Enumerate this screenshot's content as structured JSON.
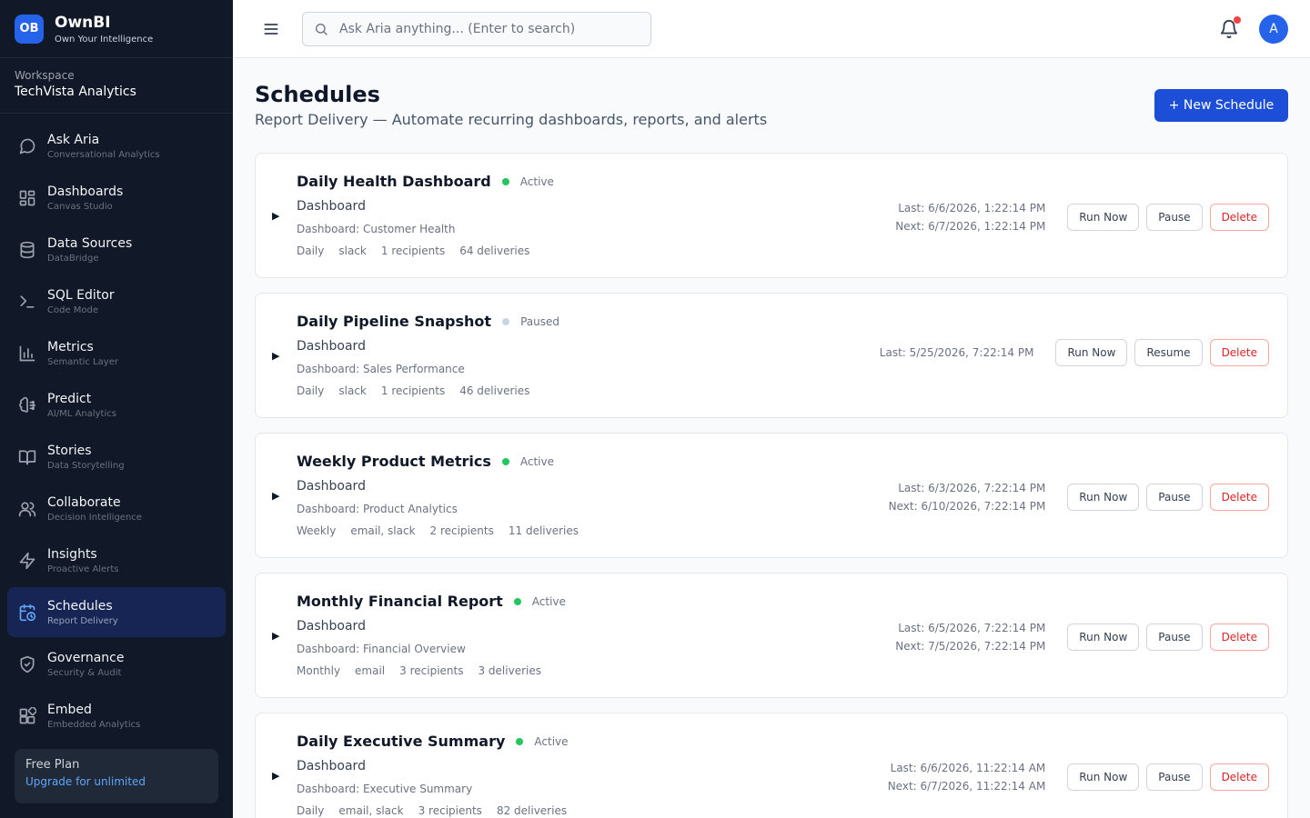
{
  "brand": {
    "logo": "OB",
    "name": "OwnBI",
    "tagline": "Own Your Intelligence"
  },
  "workspace": {
    "label": "Workspace",
    "name": "TechVista Analytics"
  },
  "nav": [
    {
      "label": "Ask Aria",
      "sub": "Conversational Analytics",
      "icon": "chat-bubble-icon"
    },
    {
      "label": "Dashboards",
      "sub": "Canvas Studio",
      "icon": "grid-icon"
    },
    {
      "label": "Data Sources",
      "sub": "DataBridge",
      "icon": "database-icon"
    },
    {
      "label": "SQL Editor",
      "sub": "Code Mode",
      "icon": "terminal-icon"
    },
    {
      "label": "Metrics",
      "sub": "Semantic Layer",
      "icon": "bar-chart-icon"
    },
    {
      "label": "Predict",
      "sub": "AI/ML Analytics",
      "icon": "brain-icon"
    },
    {
      "label": "Stories",
      "sub": "Data Storytelling",
      "icon": "book-icon"
    },
    {
      "label": "Collaborate",
      "sub": "Decision Intelligence",
      "icon": "users-icon"
    },
    {
      "label": "Insights",
      "sub": "Proactive Alerts",
      "icon": "lightning-icon"
    },
    {
      "label": "Schedules",
      "sub": "Report Delivery",
      "icon": "calendar-clock-icon",
      "active": true
    },
    {
      "label": "Governance",
      "sub": "Security & Audit",
      "icon": "shield-icon"
    },
    {
      "label": "Embed",
      "sub": "Embedded Analytics",
      "icon": "blocks-icon"
    }
  ],
  "plan": {
    "name": "Free Plan",
    "link": "Upgrade for unlimited"
  },
  "topbar": {
    "search_placeholder": "Ask Aria anything... (Enter to search)",
    "avatar": "A"
  },
  "page": {
    "title": "Schedules",
    "subtitle": "Report Delivery — Automate recurring dashboards, reports, and alerts",
    "new_button": "+ New Schedule"
  },
  "colors": {
    "active": "#22c55e",
    "paused": "#cbd5e1",
    "primary": "#1d4ed8",
    "sidebar": "#111827"
  },
  "schedules": [
    {
      "name": "Daily Health Dashboard",
      "status": "Active",
      "type": "Dashboard",
      "target": "Dashboard: Customer Health",
      "frequency": "Daily",
      "channels": "slack",
      "recipients": "1 recipients",
      "deliveries": "64 deliveries",
      "last": "Last: 6/6/2026, 1:22:14 PM",
      "next": "Next: 6/7/2026, 1:22:14 PM",
      "run": "Run Now",
      "toggle": "Pause",
      "delete": "Delete"
    },
    {
      "name": "Daily Pipeline Snapshot",
      "status": "Paused",
      "type": "Dashboard",
      "target": "Dashboard: Sales Performance",
      "frequency": "Daily",
      "channels": "slack",
      "recipients": "1 recipients",
      "deliveries": "46 deliveries",
      "last": "Last: 5/25/2026, 7:22:14 PM",
      "next": "",
      "run": "Run Now",
      "toggle": "Resume",
      "delete": "Delete"
    },
    {
      "name": "Weekly Product Metrics",
      "status": "Active",
      "type": "Dashboard",
      "target": "Dashboard: Product Analytics",
      "frequency": "Weekly",
      "channels": "email, slack",
      "recipients": "2 recipients",
      "deliveries": "11 deliveries",
      "last": "Last: 6/3/2026, 7:22:14 PM",
      "next": "Next: 6/10/2026, 7:22:14 PM",
      "run": "Run Now",
      "toggle": "Pause",
      "delete": "Delete"
    },
    {
      "name": "Monthly Financial Report",
      "status": "Active",
      "type": "Dashboard",
      "target": "Dashboard: Financial Overview",
      "frequency": "Monthly",
      "channels": "email",
      "recipients": "3 recipients",
      "deliveries": "3 deliveries",
      "last": "Last: 6/5/2026, 7:22:14 PM",
      "next": "Next: 7/5/2026, 7:22:14 PM",
      "run": "Run Now",
      "toggle": "Pause",
      "delete": "Delete"
    },
    {
      "name": "Daily Executive Summary",
      "status": "Active",
      "type": "Dashboard",
      "target": "Dashboard: Executive Summary",
      "frequency": "Daily",
      "channels": "email, slack",
      "recipients": "3 recipients",
      "deliveries": "82 deliveries",
      "last": "Last: 6/6/2026, 11:22:14 AM",
      "next": "Next: 6/7/2026, 11:22:14 AM",
      "run": "Run Now",
      "toggle": "Pause",
      "delete": "Delete"
    }
  ]
}
